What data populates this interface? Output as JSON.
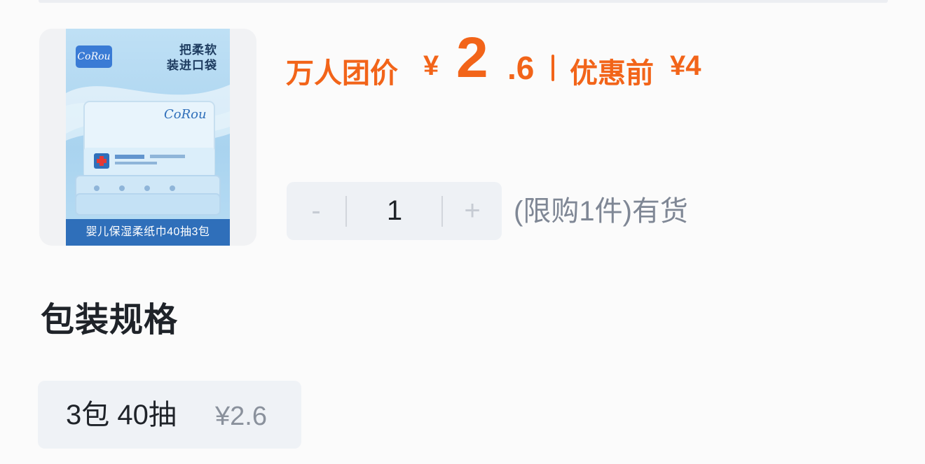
{
  "product": {
    "image": {
      "brand_badge": "CoRou",
      "slogan": "把柔软\n装进口袋",
      "pack_name": "婴儿保湿柔纸巾40抽3包"
    },
    "price": {
      "label": "万人团价",
      "currency": "¥",
      "integer_part": "2",
      "decimal_part": ".6",
      "original_label": "优惠前",
      "original_value": "¥4"
    },
    "quantity": {
      "minus_label": "-",
      "value": "1",
      "plus_label": "+",
      "stock_text": "(限购1件)有货"
    }
  },
  "spec": {
    "title": "包装规格",
    "options": [
      {
        "name": "3包 40抽",
        "price": "¥2.6"
      }
    ]
  },
  "colors": {
    "accent": "#f26419",
    "chip_bg": "#eff2f6",
    "muted_text": "#7f8795"
  }
}
